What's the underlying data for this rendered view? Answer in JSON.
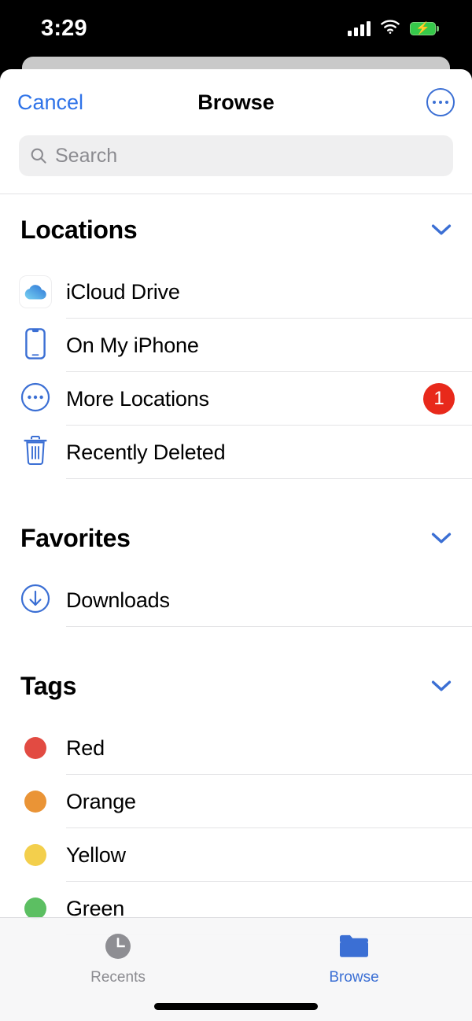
{
  "status_bar": {
    "time": "3:29",
    "cellular_icon": "signal-bars-icon",
    "wifi_icon": "wifi-icon",
    "battery_icon": "battery-charging-icon"
  },
  "navbar": {
    "cancel_label": "Cancel",
    "title": "Browse",
    "more_icon": "more-circle-icon"
  },
  "search": {
    "placeholder": "Search",
    "value": "",
    "icon": "search-icon"
  },
  "sections": [
    {
      "title": "Locations",
      "chevron_icon": "chevron-down-icon",
      "rows": [
        {
          "label": "iCloud Drive",
          "icon": "icloud-icon",
          "badge": ""
        },
        {
          "label": "On My iPhone",
          "icon": "iphone-icon",
          "badge": ""
        },
        {
          "label": "More Locations",
          "icon": "more-circle-icon",
          "badge": "1"
        },
        {
          "label": "Recently Deleted",
          "icon": "trash-icon",
          "badge": ""
        }
      ]
    },
    {
      "title": "Favorites",
      "chevron_icon": "chevron-down-icon",
      "rows": [
        {
          "label": "Downloads",
          "icon": "download-circle-icon",
          "badge": ""
        }
      ]
    },
    {
      "title": "Tags",
      "chevron_icon": "chevron-down-icon",
      "rows": [
        {
          "label": "Red",
          "icon": "tag-dot-icon",
          "color": "#e24b42",
          "badge": ""
        },
        {
          "label": "Orange",
          "icon": "tag-dot-icon",
          "color": "#ea9436",
          "badge": ""
        },
        {
          "label": "Yellow",
          "icon": "tag-dot-icon",
          "color": "#f3cf4c",
          "badge": ""
        },
        {
          "label": "Green",
          "icon": "tag-dot-icon",
          "color": "#5cbf62",
          "badge": ""
        }
      ]
    }
  ],
  "tabbar": {
    "tabs": [
      {
        "label": "Recents",
        "icon": "clock-icon",
        "active": false
      },
      {
        "label": "Browse",
        "icon": "folder-icon",
        "active": true
      }
    ]
  },
  "colors": {
    "accent": "#3b6fd4",
    "link": "#2f73e8",
    "badge": "#e8291b",
    "battery": "#36c94a",
    "search_bg": "#efeff0",
    "separator": "#e4e4e6",
    "inactive_tab": "#8b8b90"
  }
}
